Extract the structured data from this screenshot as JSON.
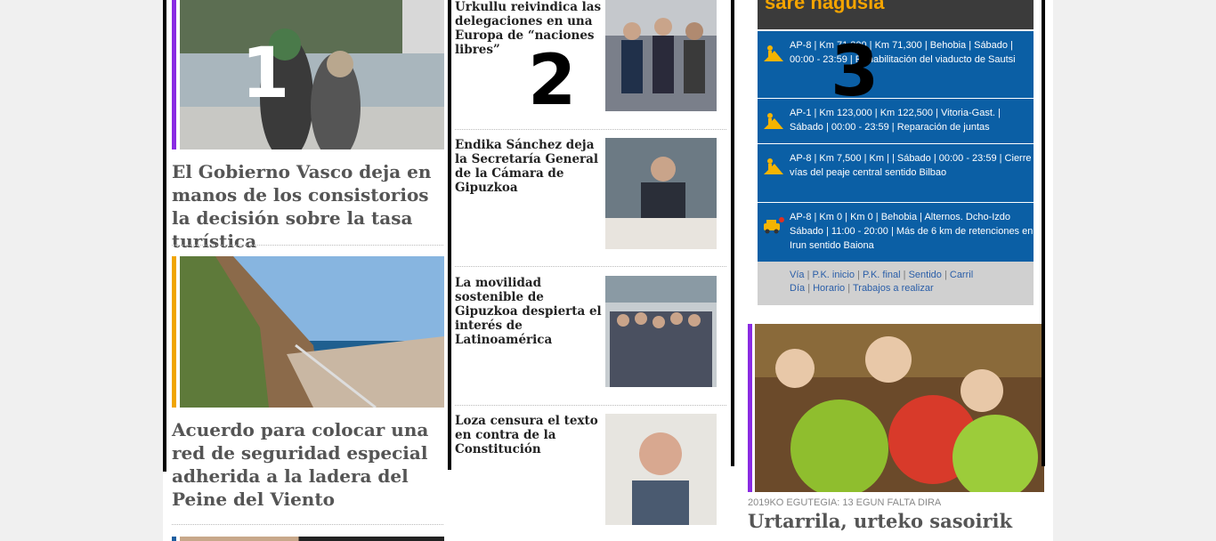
{
  "left_column": {
    "stories": [
      {
        "title": "El Gobierno Vasco deja en manos de los consistorios la decisión sobre la tasa turística",
        "accent": "#8a2be2"
      },
      {
        "title": "Acuerdo para colocar una red de seguridad especial adherida a la ladera del Peine del Viento",
        "accent": "#f0a500"
      }
    ]
  },
  "middle_column": {
    "stories": [
      {
        "title": "Urkullu reivindica las delegaciones en una Europa de “naciones libres”"
      },
      {
        "title": "Endika Sánchez deja la Secretaría General de la Cámara de Gipuzkoa"
      },
      {
        "title": "La movilidad sostenible de Gipuzkoa despierta el interés de Latinoamérica"
      },
      {
        "title": "Loza censura el texto en contra de la Constitución"
      }
    ]
  },
  "right_column": {
    "traffic_header": "sare nagusia",
    "traffic_items": [
      {
        "icon": "roadwork-icon",
        "text": "AP-8 | Km 71,300 | Km 71,300 | Behobia | Sábado | 00:00 - 23:59 | Rehabilitación del viaducto de Sautsi"
      },
      {
        "icon": "roadwork-icon",
        "text": "AP-1 | Km 123,000 | Km 122,500 | Vitoria-Gast. | Sábado | 00:00 - 23:59 | Reparación de juntas"
      },
      {
        "icon": "roadwork-icon",
        "text": "AP-8 | Km 7,500 | Km | | Sábado | 00:00 - 23:59 | Cierre vías del peaje central sentido Bilbao"
      },
      {
        "icon": "traffic-jam-icon",
        "text": "AP-8 | Km 0 | Km 0 | Behobia | Alternos. Dcho-Izdo Sábado | 11:00 - 20:00 | Más de 6 km de retenciones en Irun sentido Baiona"
      }
    ],
    "legend": {
      "row1": [
        "Vía",
        "P.K. inicio",
        "P.K. final",
        "Sentido",
        "Carril"
      ],
      "row2": [
        "Día",
        "Horario",
        "Trabajos a realizar"
      ]
    },
    "feature": {
      "kicker": "2019KO EGUTEGIA: 13 EGUN FALTA DIRA",
      "title": "Urtarrila, urteko sasoirik",
      "accent": "#8a2be2"
    }
  },
  "annotations": {
    "n1": "1",
    "n2": "2",
    "n3": "3"
  },
  "colors": {
    "traffic_blue": "#0b5fa5",
    "legend_link": "#2a5ea8"
  }
}
